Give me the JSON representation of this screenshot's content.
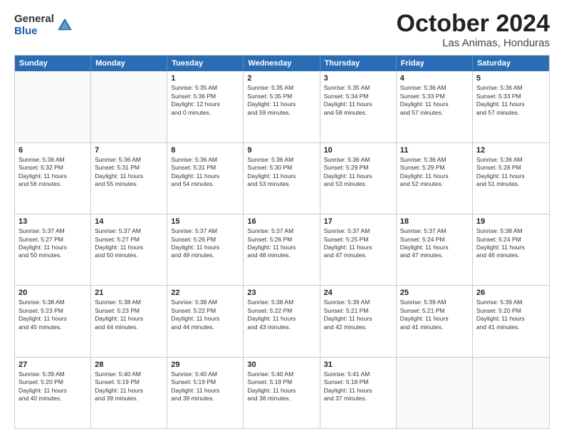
{
  "logo": {
    "general": "General",
    "blue": "Blue"
  },
  "title": "October 2024",
  "location": "Las Animas, Honduras",
  "header_days": [
    "Sunday",
    "Monday",
    "Tuesday",
    "Wednesday",
    "Thursday",
    "Friday",
    "Saturday"
  ],
  "weeks": [
    [
      {
        "day": "",
        "text": ""
      },
      {
        "day": "",
        "text": ""
      },
      {
        "day": "1",
        "text": "Sunrise: 5:35 AM\nSunset: 5:36 PM\nDaylight: 12 hours\nand 0 minutes."
      },
      {
        "day": "2",
        "text": "Sunrise: 5:35 AM\nSunset: 5:35 PM\nDaylight: 11 hours\nand 59 minutes."
      },
      {
        "day": "3",
        "text": "Sunrise: 5:35 AM\nSunset: 5:34 PM\nDaylight: 11 hours\nand 58 minutes."
      },
      {
        "day": "4",
        "text": "Sunrise: 5:36 AM\nSunset: 5:33 PM\nDaylight: 11 hours\nand 57 minutes."
      },
      {
        "day": "5",
        "text": "Sunrise: 5:36 AM\nSunset: 5:33 PM\nDaylight: 11 hours\nand 57 minutes."
      }
    ],
    [
      {
        "day": "6",
        "text": "Sunrise: 5:36 AM\nSunset: 5:32 PM\nDaylight: 11 hours\nand 56 minutes."
      },
      {
        "day": "7",
        "text": "Sunrise: 5:36 AM\nSunset: 5:31 PM\nDaylight: 11 hours\nand 55 minutes."
      },
      {
        "day": "8",
        "text": "Sunrise: 5:36 AM\nSunset: 5:31 PM\nDaylight: 11 hours\nand 54 minutes."
      },
      {
        "day": "9",
        "text": "Sunrise: 5:36 AM\nSunset: 5:30 PM\nDaylight: 11 hours\nand 53 minutes."
      },
      {
        "day": "10",
        "text": "Sunrise: 5:36 AM\nSunset: 5:29 PM\nDaylight: 11 hours\nand 53 minutes."
      },
      {
        "day": "11",
        "text": "Sunrise: 5:36 AM\nSunset: 5:29 PM\nDaylight: 11 hours\nand 52 minutes."
      },
      {
        "day": "12",
        "text": "Sunrise: 5:36 AM\nSunset: 5:28 PM\nDaylight: 11 hours\nand 51 minutes."
      }
    ],
    [
      {
        "day": "13",
        "text": "Sunrise: 5:37 AM\nSunset: 5:27 PM\nDaylight: 11 hours\nand 50 minutes."
      },
      {
        "day": "14",
        "text": "Sunrise: 5:37 AM\nSunset: 5:27 PM\nDaylight: 11 hours\nand 50 minutes."
      },
      {
        "day": "15",
        "text": "Sunrise: 5:37 AM\nSunset: 5:26 PM\nDaylight: 11 hours\nand 49 minutes."
      },
      {
        "day": "16",
        "text": "Sunrise: 5:37 AM\nSunset: 5:26 PM\nDaylight: 11 hours\nand 48 minutes."
      },
      {
        "day": "17",
        "text": "Sunrise: 5:37 AM\nSunset: 5:25 PM\nDaylight: 11 hours\nand 47 minutes."
      },
      {
        "day": "18",
        "text": "Sunrise: 5:37 AM\nSunset: 5:24 PM\nDaylight: 11 hours\nand 47 minutes."
      },
      {
        "day": "19",
        "text": "Sunrise: 5:38 AM\nSunset: 5:24 PM\nDaylight: 11 hours\nand 46 minutes."
      }
    ],
    [
      {
        "day": "20",
        "text": "Sunrise: 5:38 AM\nSunset: 5:23 PM\nDaylight: 11 hours\nand 45 minutes."
      },
      {
        "day": "21",
        "text": "Sunrise: 5:38 AM\nSunset: 5:23 PM\nDaylight: 11 hours\nand 44 minutes."
      },
      {
        "day": "22",
        "text": "Sunrise: 5:38 AM\nSunset: 5:22 PM\nDaylight: 11 hours\nand 44 minutes."
      },
      {
        "day": "23",
        "text": "Sunrise: 5:38 AM\nSunset: 5:22 PM\nDaylight: 11 hours\nand 43 minutes."
      },
      {
        "day": "24",
        "text": "Sunrise: 5:39 AM\nSunset: 5:21 PM\nDaylight: 11 hours\nand 42 minutes."
      },
      {
        "day": "25",
        "text": "Sunrise: 5:39 AM\nSunset: 5:21 PM\nDaylight: 11 hours\nand 41 minutes."
      },
      {
        "day": "26",
        "text": "Sunrise: 5:39 AM\nSunset: 5:20 PM\nDaylight: 11 hours\nand 41 minutes."
      }
    ],
    [
      {
        "day": "27",
        "text": "Sunrise: 5:39 AM\nSunset: 5:20 PM\nDaylight: 11 hours\nand 40 minutes."
      },
      {
        "day": "28",
        "text": "Sunrise: 5:40 AM\nSunset: 5:19 PM\nDaylight: 11 hours\nand 39 minutes."
      },
      {
        "day": "29",
        "text": "Sunrise: 5:40 AM\nSunset: 5:19 PM\nDaylight: 11 hours\nand 39 minutes."
      },
      {
        "day": "30",
        "text": "Sunrise: 5:40 AM\nSunset: 5:19 PM\nDaylight: 11 hours\nand 38 minutes."
      },
      {
        "day": "31",
        "text": "Sunrise: 5:41 AM\nSunset: 5:18 PM\nDaylight: 11 hours\nand 37 minutes."
      },
      {
        "day": "",
        "text": ""
      },
      {
        "day": "",
        "text": ""
      }
    ]
  ]
}
